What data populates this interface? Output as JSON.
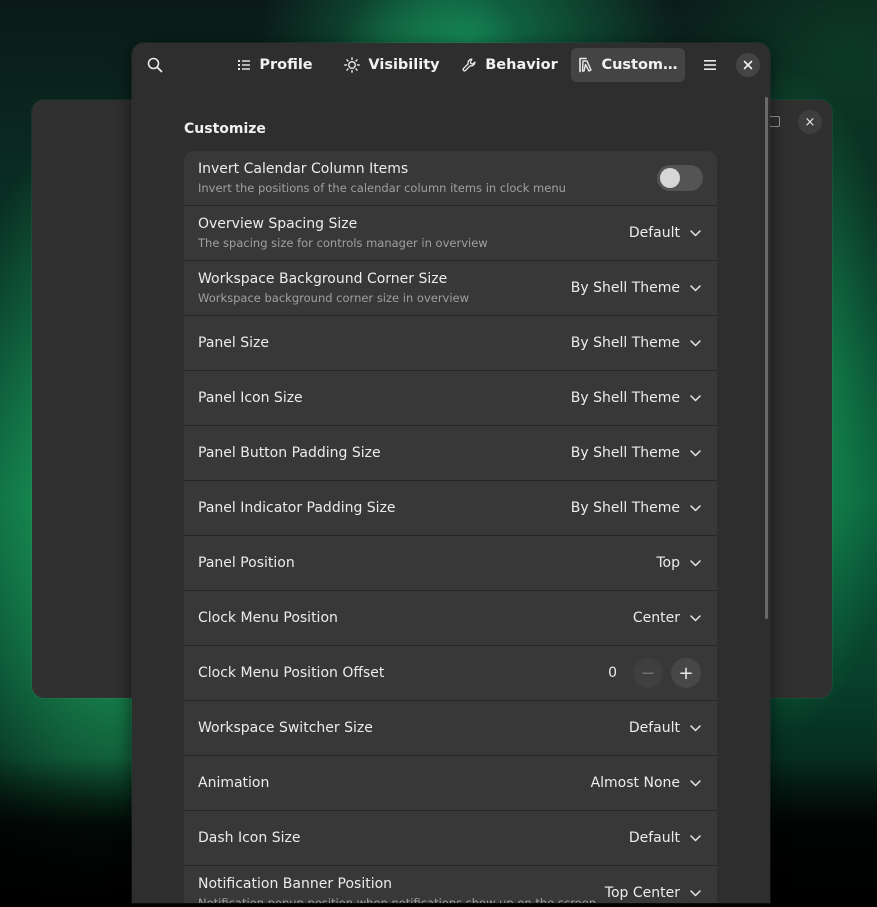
{
  "tabs": [
    {
      "label": "Profile",
      "icon": "list-icon"
    },
    {
      "label": "Visibility",
      "icon": "sun-icon"
    },
    {
      "label": "Behavior",
      "icon": "wrench-icon"
    },
    {
      "label": "Custom…",
      "icon": "customize-icon"
    }
  ],
  "active_tab": "Custom…",
  "section": {
    "title": "Customize"
  },
  "rows": [
    {
      "title": "Invert Calendar Column Items",
      "subtitle": "Invert the positions of the calendar column items in clock menu",
      "control": "toggle",
      "toggle_on": false
    },
    {
      "title": "Overview Spacing Size",
      "subtitle": "The spacing size for controls manager in overview",
      "control": "dropdown",
      "value": "Default"
    },
    {
      "title": "Workspace Background Corner Size",
      "subtitle": "Workspace background corner size in overview",
      "control": "dropdown",
      "value": "By Shell Theme"
    },
    {
      "title": "Panel Size",
      "control": "dropdown",
      "value": "By Shell Theme"
    },
    {
      "title": "Panel Icon Size",
      "control": "dropdown",
      "value": "By Shell Theme"
    },
    {
      "title": "Panel Button Padding Size",
      "control": "dropdown",
      "value": "By Shell Theme"
    },
    {
      "title": "Panel Indicator Padding Size",
      "control": "dropdown",
      "value": "By Shell Theme"
    },
    {
      "title": "Panel Position",
      "control": "dropdown",
      "value": "Top"
    },
    {
      "title": "Clock Menu Position",
      "control": "dropdown",
      "value": "Center"
    },
    {
      "title": "Clock Menu Position Offset",
      "control": "spin",
      "value": "0",
      "minus": "−",
      "plus": "+"
    },
    {
      "title": "Workspace Switcher Size",
      "control": "dropdown",
      "value": "Default"
    },
    {
      "title": "Animation",
      "control": "dropdown",
      "value": "Almost None"
    },
    {
      "title": "Dash Icon Size",
      "control": "dropdown",
      "value": "Default"
    },
    {
      "title": "Notification Banner Position",
      "subtitle": "Notification popup position when notifications show up on the screen",
      "control": "dropdown",
      "value": "Top Center"
    }
  ],
  "window_controls": {
    "close": "×",
    "back_close": "×"
  },
  "colors": {
    "window_bg": "#2e2e2e",
    "row_bg": "#383838",
    "active_tab_bg": "#444444",
    "aurora_green": "#28e678"
  }
}
